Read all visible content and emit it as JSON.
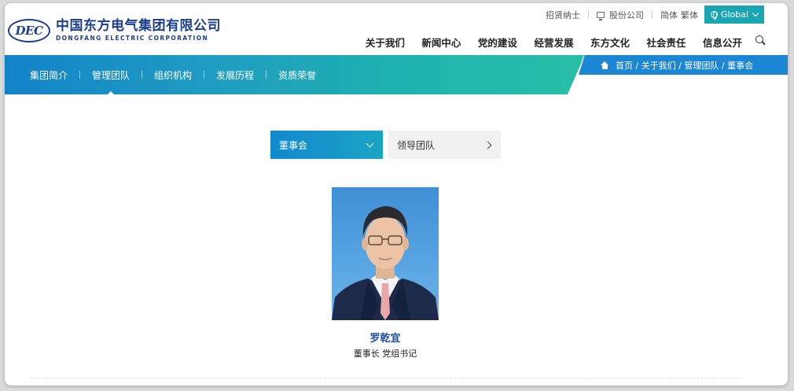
{
  "header": {
    "logo_mark": "DEC",
    "logo_cn": "中国东方电气集团有限公司",
    "logo_en": "DONGFANG ELECTRIC CORPORATION",
    "topbar": {
      "recruit": "招贤纳士",
      "stock": "股份公司",
      "lang_simplified": "简体",
      "lang_traditional": "繁体",
      "global": "Global"
    },
    "nav": [
      "关于我们",
      "新闻中心",
      "党的建设",
      "经营发展",
      "东方文化",
      "社会责任",
      "信息公开"
    ]
  },
  "subbar": {
    "items": [
      "集团简介",
      "管理团队",
      "组织机构",
      "发展历程",
      "资质荣誉"
    ],
    "active_index": 1,
    "breadcrumb": "首页 / 关于我们 / 管理团队 / 董事会"
  },
  "content": {
    "tab_active": "董事会",
    "tab_other": "领导团队",
    "member": {
      "name": "罗乾宜",
      "title": "董事长 党组书记"
    }
  },
  "colors": {
    "brand_blue": "#1d3f8f",
    "teal": "#1aa5b3",
    "banner_start": "#1383c9",
    "banner_end": "#28bea6"
  }
}
